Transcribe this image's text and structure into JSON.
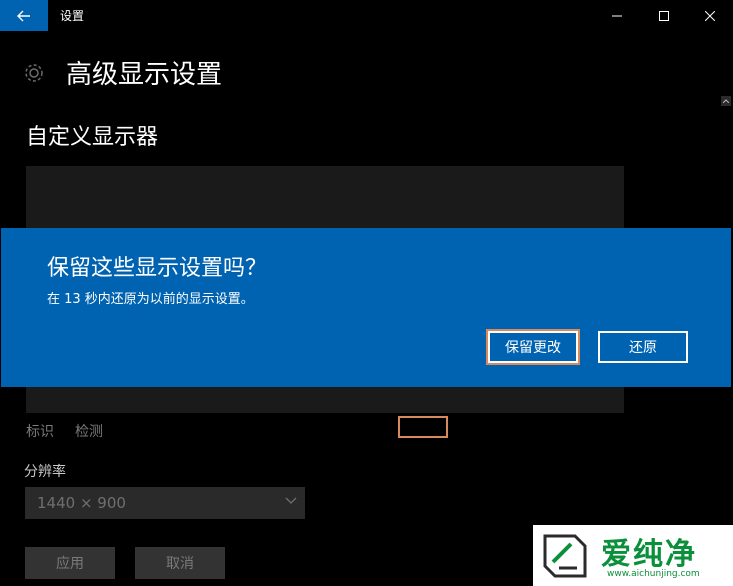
{
  "window": {
    "title": "设置",
    "back_icon": "arrow-left-icon",
    "minimize_icon": "minimize-icon",
    "maximize_icon": "maximize-icon",
    "close_icon": "close-icon"
  },
  "page": {
    "icon": "gear-icon",
    "title": "高级显示设置",
    "section_title": "自定义显示器"
  },
  "links": {
    "identify": "标识",
    "detect": "检测"
  },
  "resolution": {
    "label": "分辨率",
    "value": "1440 × 900"
  },
  "actions": {
    "apply": "应用",
    "cancel": "取消"
  },
  "dialog": {
    "title": "保留这些显示设置吗？",
    "message": "在 13 秒内还原为以前的显示设置。",
    "keep_label": "保留更改",
    "revert_label": "还原"
  },
  "watermark": {
    "text": "爱纯净",
    "url": "www.aichunjing.com"
  },
  "colors": {
    "accent": "#0063b1",
    "highlight": "#d98a5c",
    "watermark_green": "#0a8f3a"
  }
}
